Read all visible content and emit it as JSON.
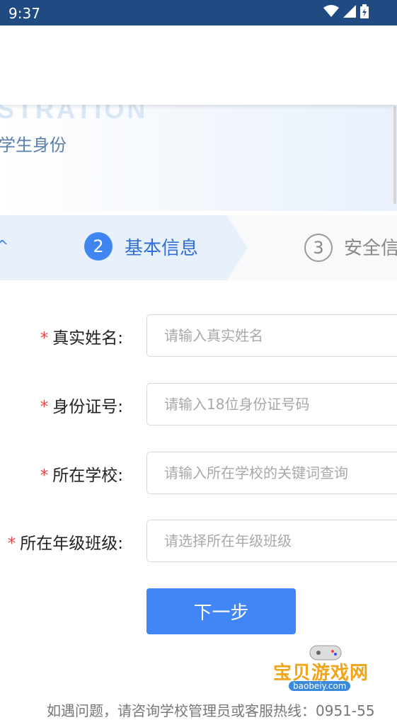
{
  "status": {
    "time": "9:37"
  },
  "banner": {
    "title": "STRATION",
    "subtitle": "学生身份"
  },
  "steps": {
    "prev_icon": "^",
    "active": {
      "number": "2",
      "label": "基本信息"
    },
    "next": {
      "number": "3",
      "label": "安全信"
    }
  },
  "form": {
    "name": {
      "label": "真实姓名:",
      "placeholder": "请输入真实姓名"
    },
    "id": {
      "label": "身份证号:",
      "placeholder": "请输入18位身份证号码"
    },
    "school": {
      "label": "所在学校:",
      "placeholder": "请输入所在学校的关键词查询"
    },
    "grade": {
      "label": "所在年级班级:",
      "placeholder": "请选择所在年级班级"
    },
    "required_mark": "*"
  },
  "next_button": "下一步",
  "footer": "如遇问题，请咨询学校管理员或客服热线：0951-55",
  "watermark": {
    "text": "宝贝游戏网",
    "sub": "baobeiy.com"
  },
  "colors": {
    "primary": "#4285f4",
    "status_bar": "#1f4a82",
    "required": "#e04848"
  }
}
